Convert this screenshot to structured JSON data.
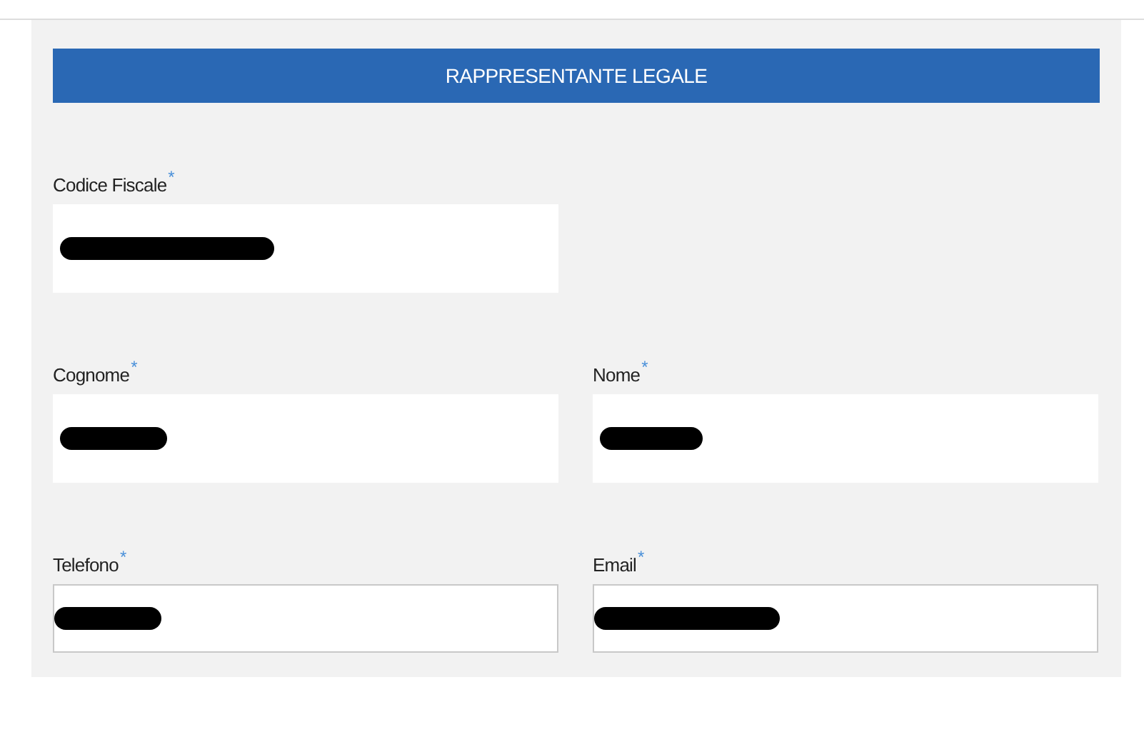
{
  "section": {
    "title": "RAPPRESENTANTE LEGALE"
  },
  "rows": [
    [
      {
        "label": "Codice Fiscale",
        "required_mark": "*",
        "outlined": false,
        "redacted": true
      }
    ],
    [
      {
        "label": "Cognome",
        "required_mark": "*",
        "outlined": false,
        "redacted": true
      },
      {
        "label": "Nome",
        "required_mark": "*",
        "outlined": false,
        "redacted": true
      }
    ],
    [
      {
        "label": "Telefono",
        "required_mark": "*",
        "outlined": true,
        "redacted": true
      },
      {
        "label": "Email",
        "required_mark": "*",
        "outlined": true,
        "redacted": true
      }
    ]
  ]
}
